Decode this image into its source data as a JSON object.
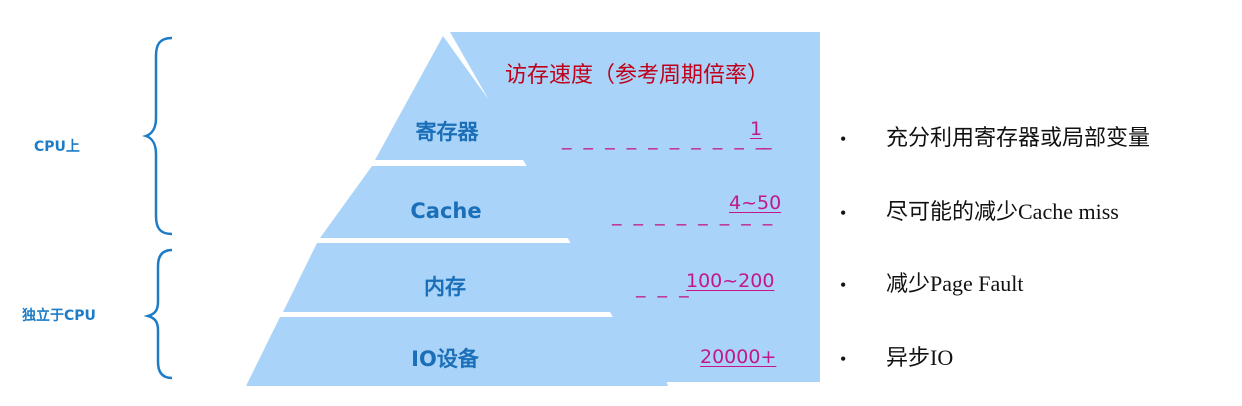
{
  "groups": {
    "on_cpu": "CPU上",
    "off_cpu": "独立于CPU"
  },
  "header": "访存速度（参考周期倍率）",
  "layers": [
    {
      "name": "寄存器",
      "speed": "1"
    },
    {
      "name": "Cache",
      "speed": "4~50"
    },
    {
      "name": "内存",
      "speed": "100~200"
    },
    {
      "name": "IO设备",
      "speed": "20000+"
    }
  ],
  "tips": [
    "充分利用寄存器或局部变量",
    "尽可能的减少Cache miss",
    "减少Page Fault",
    "异步IO"
  ],
  "colors": {
    "fill": "#a9d3f8",
    "label": "#1b6fb8",
    "header": "#c0001a",
    "speed": "#c2188b",
    "brace": "#1e7cc6"
  }
}
